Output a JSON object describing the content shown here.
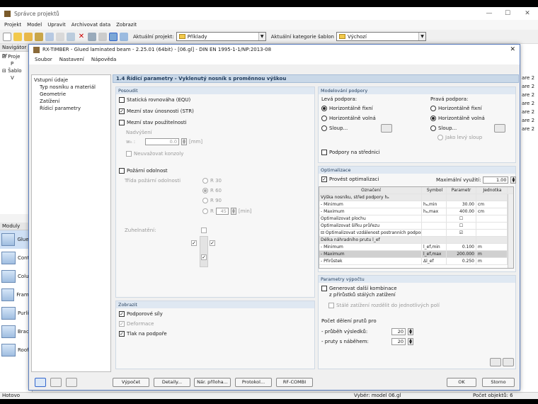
{
  "outer": {
    "title": "Správce projektů",
    "menu": [
      "Projekt",
      "Model",
      "Upravit",
      "Archivovat data",
      "Zobrazit"
    ],
    "toolbar": {
      "project_label": "Aktuální projekt:",
      "project_value": "Příklady",
      "category_label": "Aktuální kategorie šablon",
      "category_value": "Výchozí"
    },
    "nav": {
      "header": "Navigátor pr",
      "items": [
        "Proje",
        "P",
        "Šablo",
        "V"
      ]
    },
    "modules": {
      "header": "Moduly",
      "items": [
        "Glued",
        "Conti",
        "Colun",
        "Frame",
        "Purlin",
        "Brace",
        "Roof"
      ]
    },
    "right_col": [
      "are",
      "are",
      "are",
      "are",
      "are",
      "are",
      "are"
    ],
    "right_col2": [
      "2",
      "2",
      "2",
      "2",
      "2",
      "2",
      "2"
    ],
    "status_left": "Hotovo",
    "status_mid": "Vybér: model 06.gl",
    "status_right": "Počet objektů: 6"
  },
  "dialog": {
    "title": "RX-TIMBER - Glued laminated beam - 2.25.01 (64bit) - [06.gl] - DIN EN 1995-1-1/NP:2013-08",
    "menu": [
      "Soubor",
      "Nastavení",
      "Nápověda"
    ],
    "tree": [
      "Vstupní údaje",
      "Typ nosníku a materiál",
      "Geometrie",
      "Zatížení",
      "Řídicí parametry"
    ],
    "header": "1.4 Řídicí parametry  -  Vyklenutý nosník s proměnnou výškou",
    "posoudit": {
      "title": "Posoudit",
      "equ": "Statická rovnováha (EQU)",
      "str": "Mezní stav únosnosti (STR)",
      "sls": "Mezní stav použitelnosti",
      "nadvyseni": "Nadvýšení",
      "wc": "wₙ :",
      "wc_val": "0.0",
      "wc_unit": "[mm]",
      "konzoly": "Neuvažovat konzoly",
      "pozar": "Požární odolnost",
      "trida": "Třída požární odolnosti",
      "r30": "R 30",
      "r60": "R 60",
      "r90": "R 90",
      "r": "R",
      "r_val": "45",
      "r_unit": "[min]",
      "zuhelnateni": "Zuhelnatění:"
    },
    "zobrazit": {
      "title": "Zobrazit",
      "podporove": "Podporové síly",
      "deformace": "Deformace",
      "tlak": "Tlak na podpoře"
    },
    "modelovani": {
      "title": "Modelování podpory",
      "leva": "Levá podpora:",
      "prava": "Pravá podpora:",
      "hf": "Horizontálně fixní",
      "hv": "Horizontálně volná",
      "sloup": "Sloup...",
      "jako": "Jako levý sloup",
      "stred": "Podpory na střednici"
    },
    "optimalizace": {
      "title": "Optimalizace",
      "provest": "Provést optimalizaci",
      "max_label": "Maximální využití:",
      "max_val": "1.00",
      "cols": [
        "Označení",
        "Symbol",
        "Parametr",
        "Jednotka"
      ],
      "rows": [
        {
          "o": "Výška nosníku, střed podpory  hₐ",
          "s": "",
          "p": "",
          "u": "",
          "cls": "sec"
        },
        {
          "o": "- Minimum",
          "s": "hₐ,min",
          "p": "30.00",
          "u": "cm",
          "cls": ""
        },
        {
          "o": "- Maximum",
          "s": "hₐ,max",
          "p": "400.00",
          "u": "cm",
          "cls": ""
        },
        {
          "o": "Optimalizovat plochu",
          "s": "",
          "p": "☐",
          "u": "",
          "cls": ""
        },
        {
          "o": "Optimalizovat šířku průřezu",
          "s": "",
          "p": "☐",
          "u": "",
          "cls": ""
        },
        {
          "o": "⊟ Optimalizovat vzdálenost postranních podpor",
          "s": "",
          "p": "☑",
          "u": "",
          "cls": ""
        },
        {
          "o": "Délka náhradního prutu  l_ef",
          "s": "",
          "p": "",
          "u": "",
          "cls": "sec"
        },
        {
          "o": "- Minimum",
          "s": "l_ef,min",
          "p": "0.100",
          "u": "m",
          "cls": ""
        },
        {
          "o": "- Maximum",
          "s": "l_ef,max",
          "p": "200.000",
          "u": "m",
          "cls": "dark"
        },
        {
          "o": "- Přírůstek",
          "s": "Δl_ef",
          "p": "0.250",
          "u": "m",
          "cls": ""
        }
      ]
    },
    "parametry": {
      "title": "Parametry výpočtu",
      "generovat": "Generovat další kombinace\nz přírůstků stálých zatížení",
      "stale": "Stálé zatížení rozdělit do jednotlivých polí",
      "pocet": "Počet dělení prutů pro",
      "prubeh": "- průběh výsledků:",
      "prubeh_val": "20",
      "nabeh": "- pruty s náběhem:",
      "nabeh_val": "20"
    },
    "buttons": {
      "vypocet": "Výpočet",
      "detaily": "Detaily...",
      "nar": "Nár. příloha...",
      "protokol": "Protokol...",
      "rfcombi": "RF-COMBI",
      "ok": "OK",
      "storno": "Storno"
    }
  }
}
